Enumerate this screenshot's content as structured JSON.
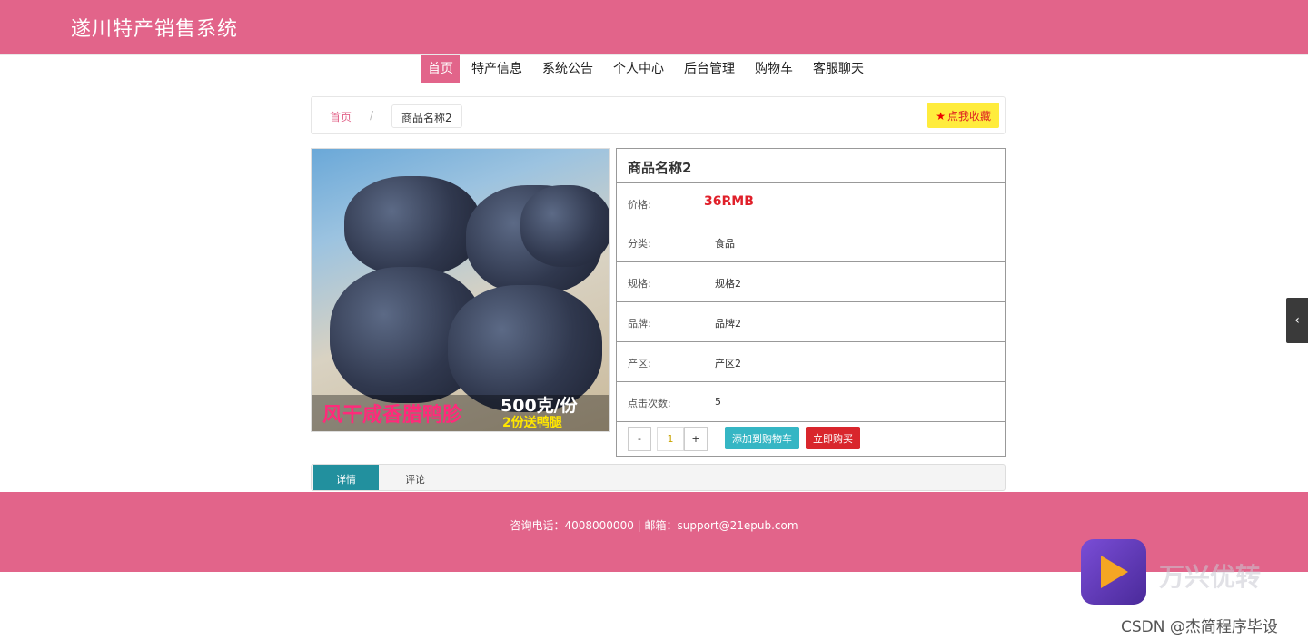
{
  "header": {
    "site_title": "遂川特产销售系统"
  },
  "nav": {
    "items": [
      {
        "label": "首页",
        "active": true
      },
      {
        "label": "特产信息"
      },
      {
        "label": "系统公告"
      },
      {
        "label": "个人中心"
      },
      {
        "label": "后台管理"
      },
      {
        "label": "购物车"
      },
      {
        "label": "客服聊天"
      }
    ]
  },
  "breadcrumb": {
    "home": "首页",
    "separator": "/",
    "current": "商品名称2"
  },
  "favorite": {
    "label": "点我收藏",
    "icon": "star-icon"
  },
  "image": {
    "caption_left": "风干咸香腊鸭胗",
    "caption_right": "500克/份",
    "caption_sub": "2份送鸭腿"
  },
  "product": {
    "name": "商品名称2",
    "fields": [
      {
        "label": "价格:",
        "value": "36RMB"
      },
      {
        "label": "分类:",
        "value": "食品"
      },
      {
        "label": "规格:",
        "value": "规格2"
      },
      {
        "label": "品牌:",
        "value": "品牌2"
      },
      {
        "label": "产区:",
        "value": "产区2"
      },
      {
        "label": "点击次数:",
        "value": "5"
      }
    ],
    "quantity": "1",
    "minus_label": "-",
    "plus_label": "+",
    "add_to_cart": "添加到购物车",
    "buy_now": "立即购买"
  },
  "tabs": [
    {
      "label": "详情"
    },
    {
      "label": "评论"
    }
  ],
  "footer": {
    "text": "咨询电话：4008000000 | 邮箱：support@21epub.com"
  },
  "side_toggle": {
    "icon": "chevron-left-icon",
    "glyph": "‹"
  },
  "watermark": {
    "text": "万兴优转",
    "csdn": "CSDN @杰简程序毕设"
  },
  "colors": {
    "brand": "#e2648a",
    "price": "#e0202a",
    "cart_button": "#35b6c4",
    "buy_button": "#d9262c",
    "tab_active": "#22909e"
  }
}
